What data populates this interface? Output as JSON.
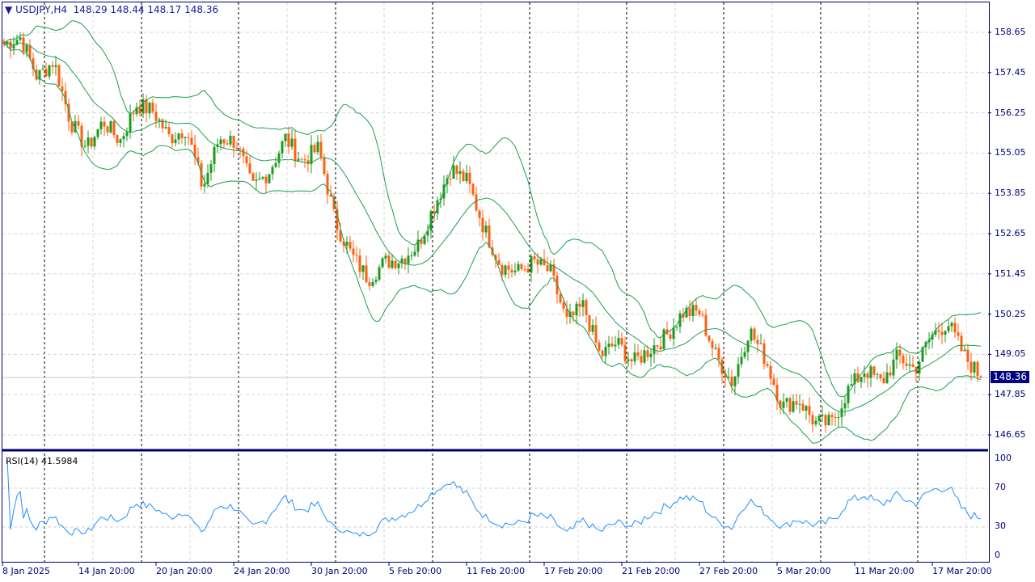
{
  "header": {
    "symbol": "USDJPY,H4",
    "open": "148.29",
    "high": "148.44",
    "low": "148.17",
    "close": "148.36"
  },
  "current_price": "148.36",
  "rsi": {
    "label": "RSI(14) 41.5984",
    "levels": [
      "100",
      "70",
      "30",
      "0"
    ]
  },
  "price_axis": [
    "158.65",
    "157.45",
    "156.25",
    "155.05",
    "153.85",
    "152.65",
    "151.45",
    "150.25",
    "149.05",
    "147.85",
    "146.65"
  ],
  "time_axis": [
    "8 Jan 2025",
    "14 Jan 20:00",
    "20 Jan 20:00",
    "24 Jan 20:00",
    "30 Jan 20:00",
    "5 Feb 20:00",
    "11 Feb 20:00",
    "17 Feb 20:00",
    "21 Feb 20:00",
    "27 Feb 20:00",
    "5 Mar 20:00",
    "11 Mar 20:00",
    "17 Mar 20:00"
  ],
  "colors": {
    "bull": "#1f9a1f",
    "bear": "#ff6010",
    "bands": "#1aa050",
    "rsi": "#1e90ff"
  },
  "chart_data": {
    "type": "candlestick",
    "ylim": [
      146.3,
      159.5
    ],
    "key_closes": [
      158.3,
      158.5,
      157.3,
      157.8,
      156.0,
      155.2,
      156.0,
      155.4,
      156.5,
      156.3,
      155.5,
      155.8,
      154.0,
      155.5,
      155.4,
      154.0,
      154.5,
      155.5,
      154.8,
      155.2,
      153.0,
      152.0,
      151.3,
      151.8,
      151.9,
      152.3,
      153.5,
      154.6,
      154.2,
      152.8,
      151.7,
      151.5,
      151.8,
      151.5,
      150.0,
      150.5,
      149.0,
      149.4,
      148.8,
      149.2,
      149.6,
      150.3,
      150.3,
      149.0,
      148.2,
      149.8,
      148.9,
      147.5,
      147.7,
      147.0,
      147.0,
      148.0,
      148.6,
      148.2,
      149.0,
      148.6,
      149.6,
      150.0,
      149.0,
      148.36
    ]
  }
}
